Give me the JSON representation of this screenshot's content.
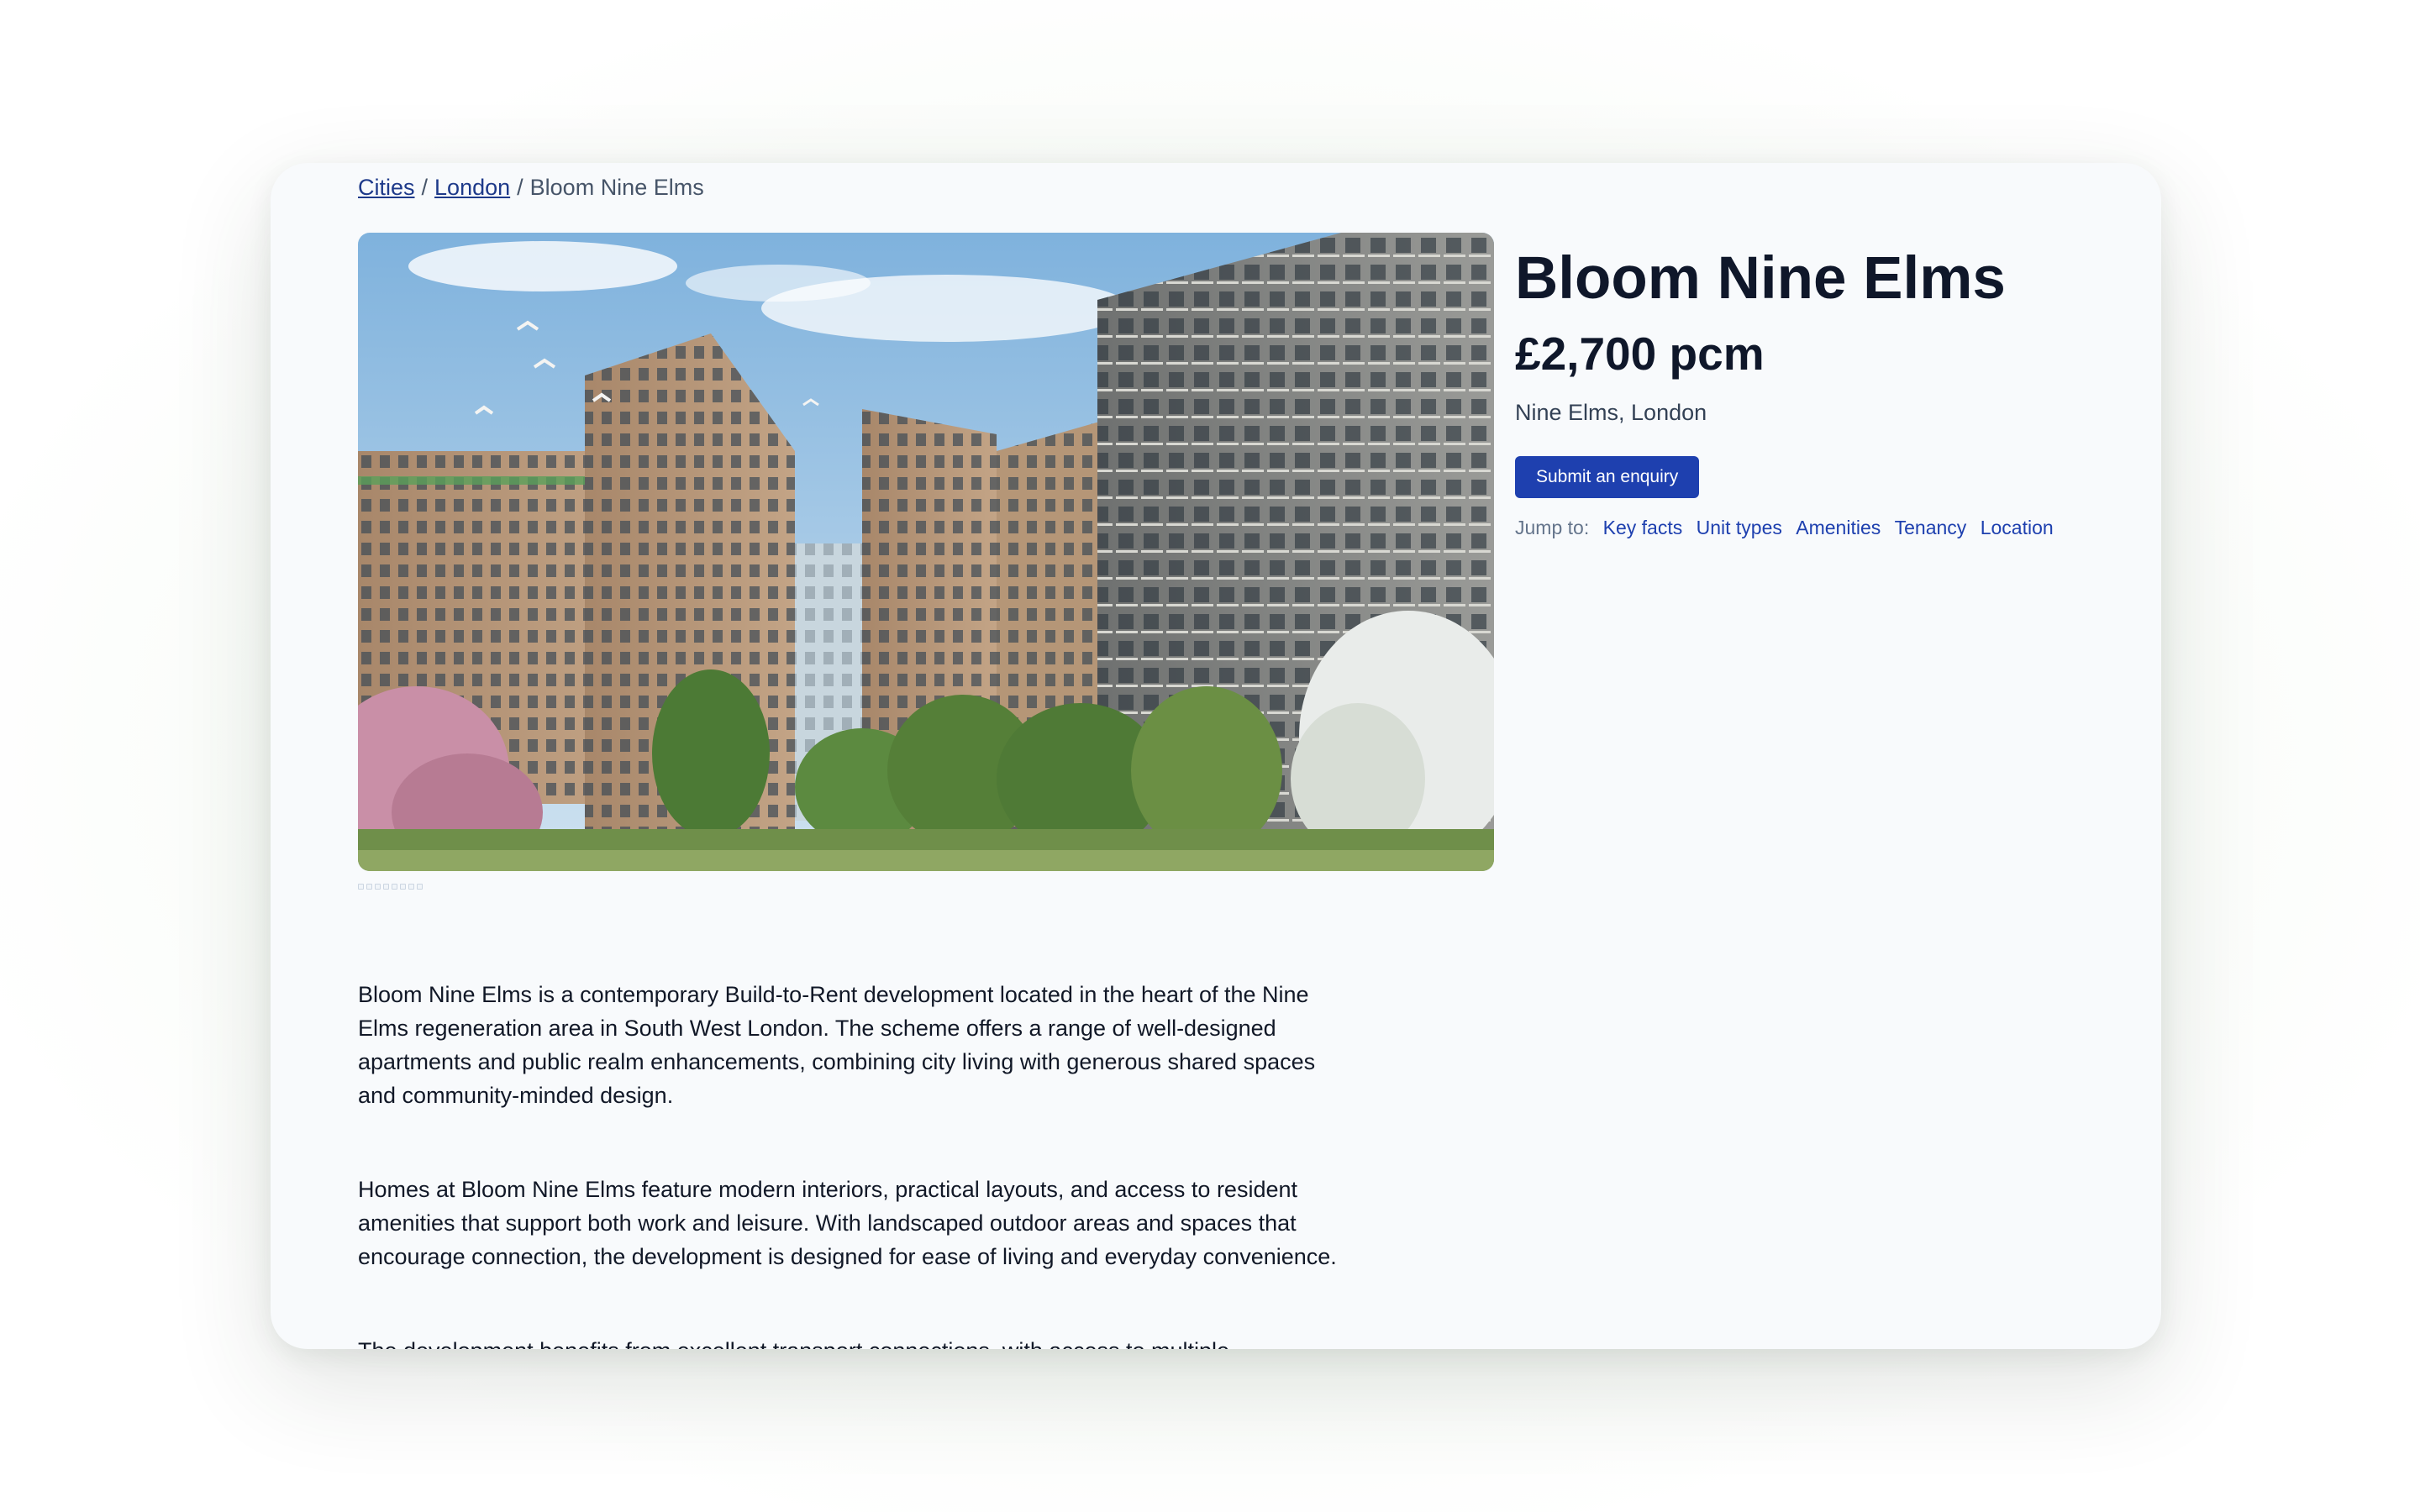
{
  "breadcrumb": {
    "items": [
      "Cities",
      "London"
    ],
    "separator": "/",
    "current": "Bloom Nine Elms"
  },
  "property": {
    "title": "Bloom Nine Elms",
    "price": "£2,700 pcm",
    "location": "Nine Elms, London",
    "enquiry_label": "Submit an enquiry"
  },
  "jump": {
    "label": "Jump to:",
    "links": [
      "Key facts",
      "Unit types",
      "Amenities",
      "Tenancy",
      "Location"
    ]
  },
  "description": [
    "Bloom Nine Elms is a contemporary Build-to-Rent development located in the heart of the Nine Elms regeneration area in South West London. The scheme offers a range of well-designed apartments and public realm enhancements, combining city living with generous shared spaces and community-minded design.",
    "Homes at Bloom Nine Elms feature modern interiors, practical layouts, and access to resident amenities that support both work and leisure. With landscaped outdoor areas and spaces that encourage connection, the development is designed for ease of living and everyday convenience.",
    "The development benefits from excellent transport connections, with access to multiple"
  ],
  "colors": {
    "accent": "#1e40af",
    "link": "#1e3a8a",
    "text": "#0f172a",
    "card": "#f8fafc"
  }
}
